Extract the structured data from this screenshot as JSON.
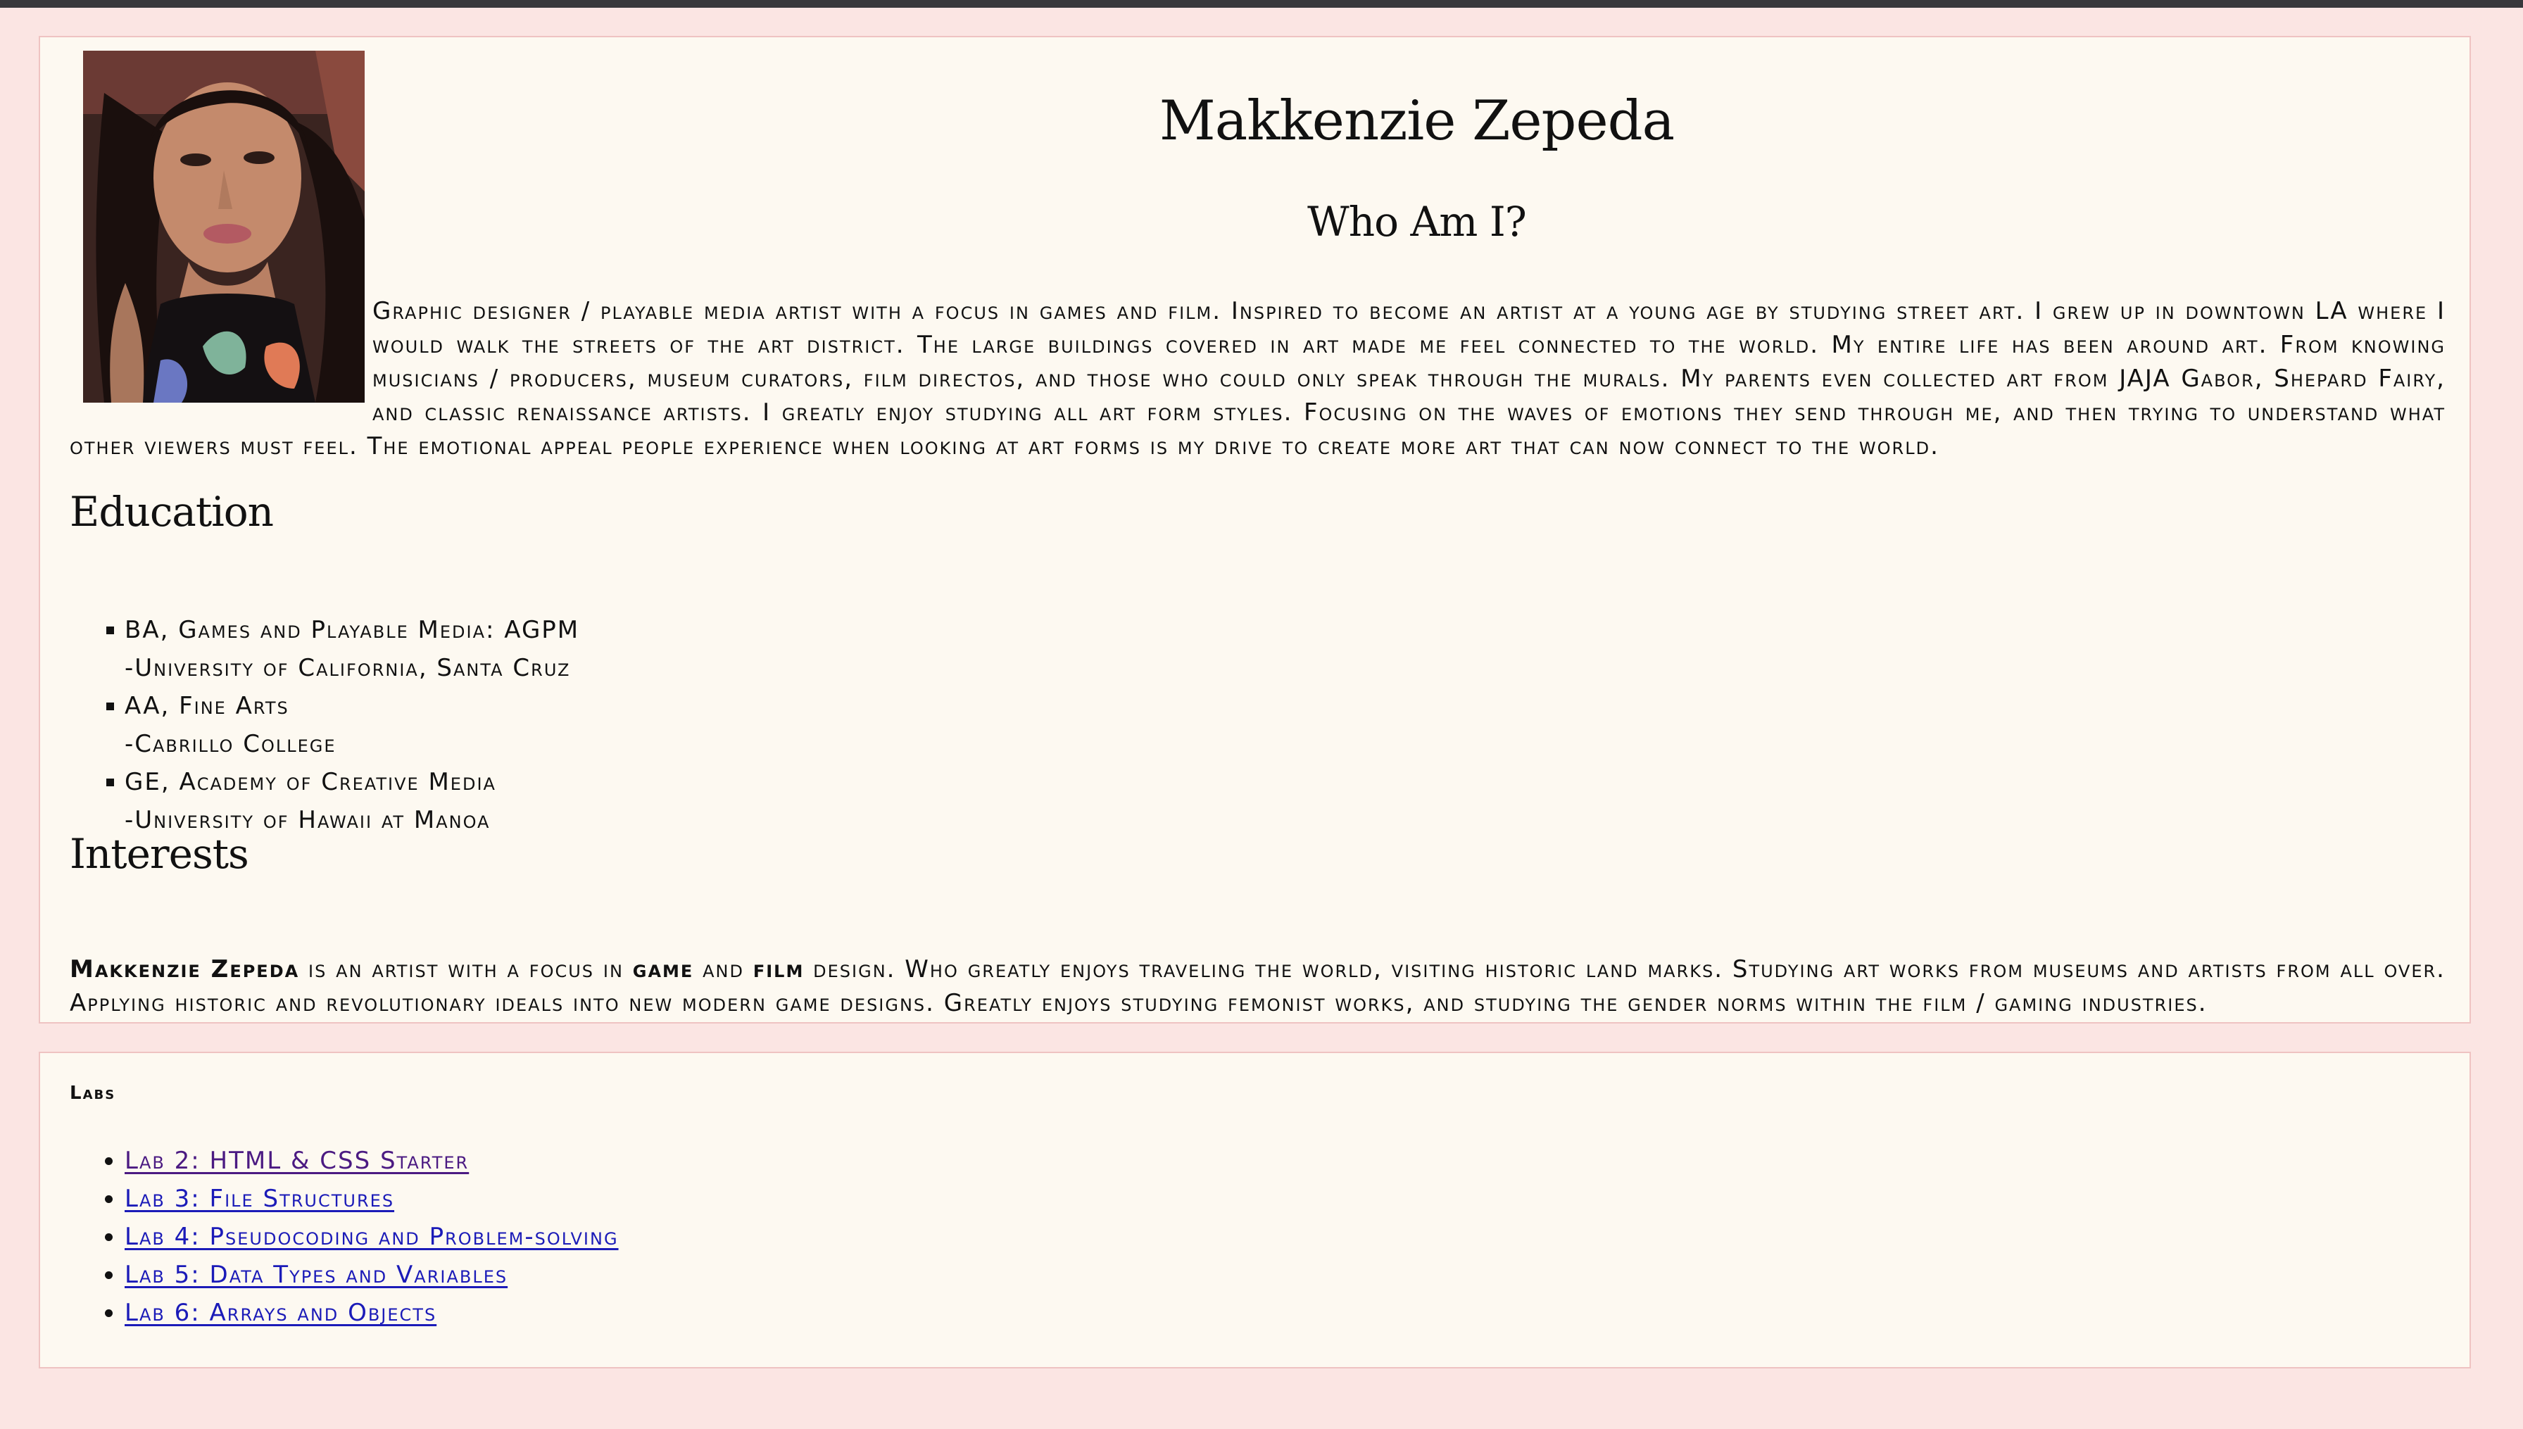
{
  "colors": {
    "page_background": "#fbe5e3",
    "card_background": "#fdf9f1",
    "card_border": "#efc3c2",
    "link": "#1b1bb8",
    "visited_link": "#4b1a82",
    "topbar": "#38383c"
  },
  "profile": {
    "photo_icon": "portrait-photo",
    "name": "Makkenzie Zepeda",
    "subtitle": "Who Am I?",
    "bio": "Graphic designer / playable media artist with a focus in games and film. Inspired to become an artist at a young age by studying street art. I grew up in downtown LA where I would walk the streets of the art district. The large buildings covered in art made me feel connected to the world. My entire life has been around art. From knowing musicians / producers, museum curators, film directos, and those who could only speak through the murals. My parents even collected art from JAJA Gabor, Shepard Fairy, and classic renaissance artists. I greatly enjoy studying all art form styles. Focusing on the waves of emotions they send through me, and then trying to understand what other viewers must feel. The emotional appeal people experience when looking at art forms is my drive to create more art that can now connect to the world."
  },
  "education": {
    "title": "Education",
    "items": [
      {
        "degree": "BA, Games and Playable Media: AGPM",
        "school": "-University of California, Santa Cruz"
      },
      {
        "degree": "AA, Fine Arts",
        "school": "-Cabrillo College"
      },
      {
        "degree": "GE, Academy of Creative Media",
        "school": "-University of Hawaii at Manoa"
      }
    ]
  },
  "interests": {
    "title": "Interests",
    "name": "Makkenzie Zepeda",
    "text_1": " is an artist with a focus in ",
    "game": "game",
    "text_2": " and ",
    "film": "film",
    "text_3": " design. Who greatly enjoys traveling the world, visiting historic land marks. Studying art works from museums and artists from all over. Applying historic and revolutionary ideals into new modern game designs. Greatly enjoys studying femonist works, and studying the gender norms within the film / gaming industries."
  },
  "labs": {
    "title": "Labs",
    "links": [
      {
        "label": "Lab 2: HTML & CSS Starter",
        "visited": true
      },
      {
        "label": "Lab 3: File Structures",
        "visited": false
      },
      {
        "label": "Lab 4: Pseudocoding and Problem-solving",
        "visited": false
      },
      {
        "label": "Lab 5: Data Types and Variables",
        "visited": false
      },
      {
        "label": "Lab 6: Arrays and Objects",
        "visited": false
      }
    ]
  }
}
